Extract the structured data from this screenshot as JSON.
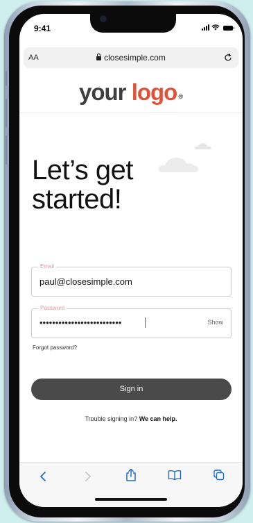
{
  "status_bar": {
    "time": "9:41"
  },
  "browser": {
    "text_size_label": "AA",
    "url": "closesimple.com",
    "reload_icon": "reload-icon",
    "toolbar_icons": [
      "back-icon",
      "forward-icon",
      "share-icon",
      "bookmarks-icon",
      "tabs-icon"
    ]
  },
  "logo": {
    "part1": "your",
    "part2": "logo",
    "registered": "®"
  },
  "heading": {
    "line1": "Let’s get",
    "line2": "started!"
  },
  "form": {
    "email_label": "Email",
    "email_value": "paul@closesimple.com",
    "password_label": "Password",
    "password_value": "••••••••••••••••••••••••••",
    "show_label": "Show",
    "forgot_label": "Forgot password?",
    "signin_label": "Sign in",
    "trouble_text": "Trouble signing in?",
    "help_link": "We can help."
  },
  "colors": {
    "logo_accent": "#e0533b",
    "logo_dark": "#3e3e3e",
    "button": "#4a4a4a",
    "link_blue": "#1f6ec8",
    "field_label": "#d79aa0",
    "background": "#cfeeee"
  }
}
